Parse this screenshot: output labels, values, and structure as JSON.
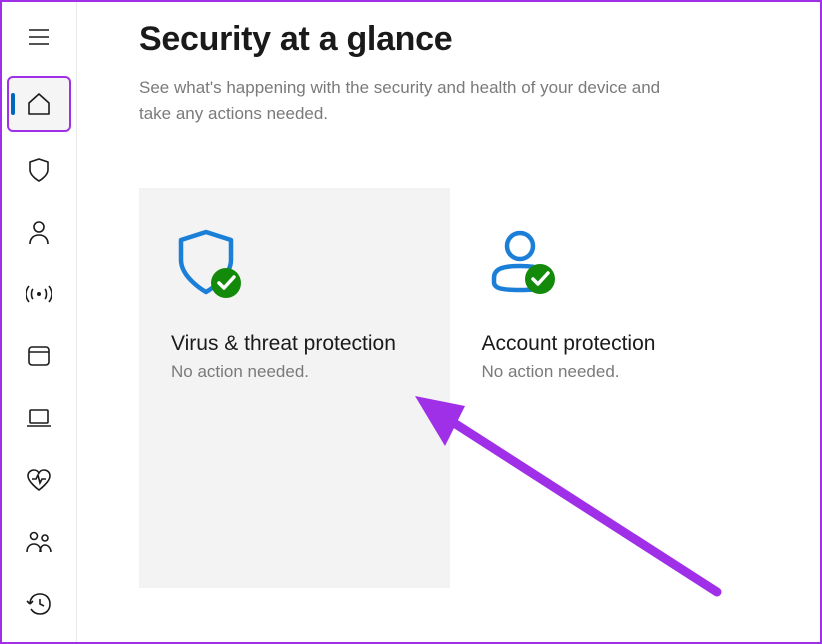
{
  "header": {
    "title": "Security at a glance",
    "subtitle": "See what's happening with the security and health of your device and take any actions needed."
  },
  "sidebar": {
    "items": [
      {
        "name": "menu",
        "active": false
      },
      {
        "name": "home",
        "active": true
      },
      {
        "name": "virus-threat",
        "active": false
      },
      {
        "name": "account-protection",
        "active": false
      },
      {
        "name": "firewall-network",
        "active": false
      },
      {
        "name": "app-browser",
        "active": false
      },
      {
        "name": "device-security",
        "active": false
      },
      {
        "name": "device-performance",
        "active": false
      },
      {
        "name": "family-options",
        "active": false
      },
      {
        "name": "protection-history",
        "active": false
      }
    ]
  },
  "cards": [
    {
      "title": "Virus & threat protection",
      "status": "No action needed.",
      "icon": "shield-check",
      "highlighted": true
    },
    {
      "title": "Account protection",
      "status": "No action needed.",
      "icon": "person-check",
      "highlighted": false
    }
  ],
  "colors": {
    "accent_blue": "#0067c0",
    "icon_blue": "#1b7fd8",
    "status_green": "#138a0a",
    "annotation_purple": "#a030e8",
    "text_gray": "#7a7a7a"
  }
}
